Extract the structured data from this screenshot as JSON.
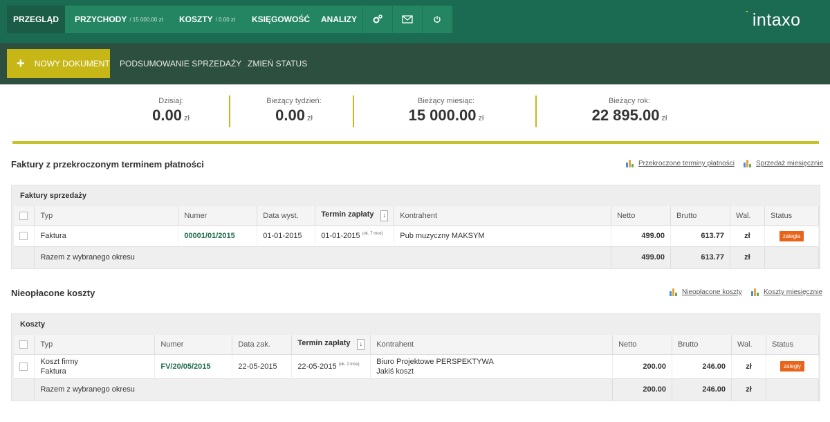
{
  "nav": {
    "overview": "PRZEGLĄD",
    "income": "PRZYCHODY",
    "income_amount": "/ 15 000.00 zł",
    "costs": "KOSZTY",
    "costs_amount": "/ 0.00 zł",
    "accounting": "KSIĘGOWOŚĆ",
    "analysis": "ANALIZY",
    "icons": [
      "settings-icon",
      "mail-icon",
      "power-icon"
    ]
  },
  "logo": {
    "text": "intaxo",
    "tick": "`"
  },
  "actions": {
    "plus": "+",
    "new_document": "NOWY DOKUMENT",
    "sales_summary": "PODSUMOWANIE SPRZEDAŻY",
    "change_status": "ZMIEŃ STATUS"
  },
  "stats": [
    {
      "label": "Dzisiaj:",
      "value": "0.00",
      "currency": "zł"
    },
    {
      "label": "Bieżący tydzień:",
      "value": "0.00",
      "currency": "zł"
    },
    {
      "label": "Bieżący miesiąc:",
      "value": "15 000.00",
      "currency": "zł"
    },
    {
      "label": "Bieżący rok:",
      "value": "22 895.00",
      "currency": "zł"
    }
  ],
  "overdue": {
    "title": "Faktury z przekroczonym terminem płatności",
    "link1": "Przekroczone terminy płatności",
    "link2": "Sprzedaż miesięcznie",
    "table": {
      "caption": "Faktury sprzedaży",
      "headers": [
        "Typ",
        "Numer",
        "Data wyst.",
        "Termin zapłaty",
        "Kontrahent",
        "Netto",
        "Brutto",
        "Wal.",
        "Status"
      ],
      "sort_icon": "↓",
      "row": {
        "type": "Faktura",
        "number": "00001/01/2015",
        "date": "01-01-2015",
        "due": "01-01-2015",
        "due_note": "(ok. 7 mce)",
        "contractor": "Pub muzyczny MAKSYM",
        "net": "499.00",
        "gross": "613.77",
        "currency": "zł",
        "status": "zaległa"
      },
      "sum": {
        "label": "Razem z wybranego okresu",
        "net": "499.00",
        "gross": "613.77",
        "currency": "zł"
      }
    }
  },
  "unpaid": {
    "title": "Nieopłacone koszty",
    "link1": "Nieopłacone koszty",
    "link2": "Koszty miesięcznie",
    "table": {
      "caption": "Koszty",
      "headers": [
        "Typ",
        "Numer",
        "Data zak.",
        "Termin zapłaty",
        "Kontrahent",
        "Netto",
        "Brutto",
        "Wal.",
        "Status"
      ],
      "sort_icon": "↓",
      "row": {
        "type_line1": "Koszt firmy",
        "type_line2": "Faktura",
        "number": "FV/20/05/2015",
        "date": "22-05-2015",
        "due": "22-05-2015",
        "due_note": "(ok. 2 mce)",
        "contractor_line1": "Biuro Projektowe PERSPEKTYWA",
        "contractor_line2": "Jakiś koszt",
        "net": "200.00",
        "gross": "246.00",
        "currency": "zł",
        "status": "zaległy"
      },
      "sum": {
        "label": "Razem z wybranego okresu",
        "net": "200.00",
        "gross": "246.00",
        "currency": "zł"
      }
    }
  },
  "colors": {
    "nav_bg": "#1b6a52",
    "action_bg": "#2d4f40",
    "accent_yellow": "#c7b716",
    "status_orange": "#e8641b",
    "link_green": "#1e6b4a"
  }
}
